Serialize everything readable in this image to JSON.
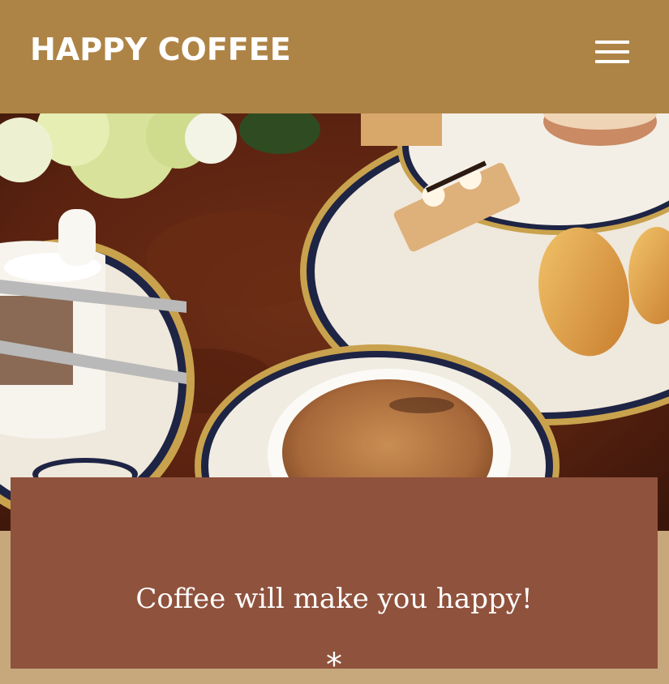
{
  "header": {
    "brand": "HAPPY COFFEE",
    "menu_icon": "hamburger-menu-icon"
  },
  "hero": {
    "image_subject": "coffee-and-pastries-photo"
  },
  "card": {
    "tagline": "Coffee will make you happy!",
    "ornament_icon": "asterisk-ornament-icon"
  },
  "colors": {
    "header_bg": "#ae8446",
    "card_bg": "#8f523d",
    "band_bg": "#c6a87c",
    "text": "#ffffff"
  }
}
